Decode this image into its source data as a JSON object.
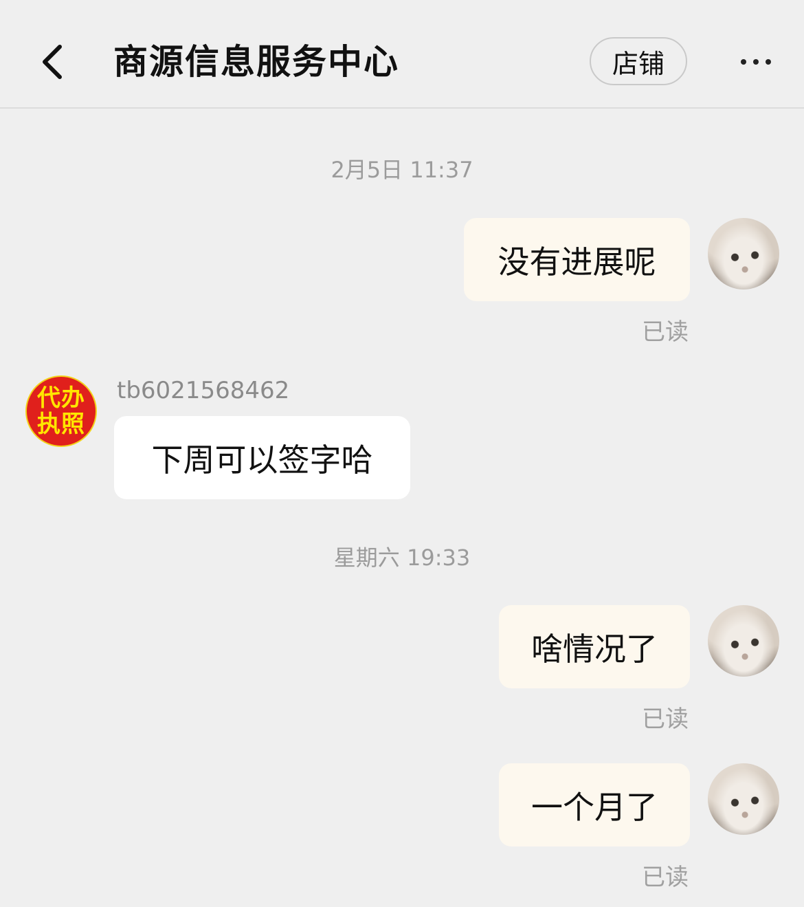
{
  "header": {
    "title": "商源信息服务中心",
    "shop_label": "店铺"
  },
  "chat": {
    "timestamps": [
      "2月5日 11:37",
      "星期六 19:33"
    ],
    "messages": [
      {
        "from": "me",
        "text": "没有进展呢",
        "status": "已读"
      },
      {
        "from": "them",
        "sender": "tb6021568462",
        "text": "下周可以签字哈"
      },
      {
        "from": "me",
        "text": "啥情况了",
        "status": "已读"
      },
      {
        "from": "me",
        "text": "一个月了",
        "status": "已读"
      }
    ],
    "shop_avatar_text": [
      "代办",
      "执照"
    ]
  },
  "colors": {
    "background": "#efefef",
    "my_bubble": "#fdf8ee",
    "their_bubble": "#ffffff",
    "shop_avatar_bg": "#e0201c",
    "shop_avatar_text": "#ffe600"
  }
}
